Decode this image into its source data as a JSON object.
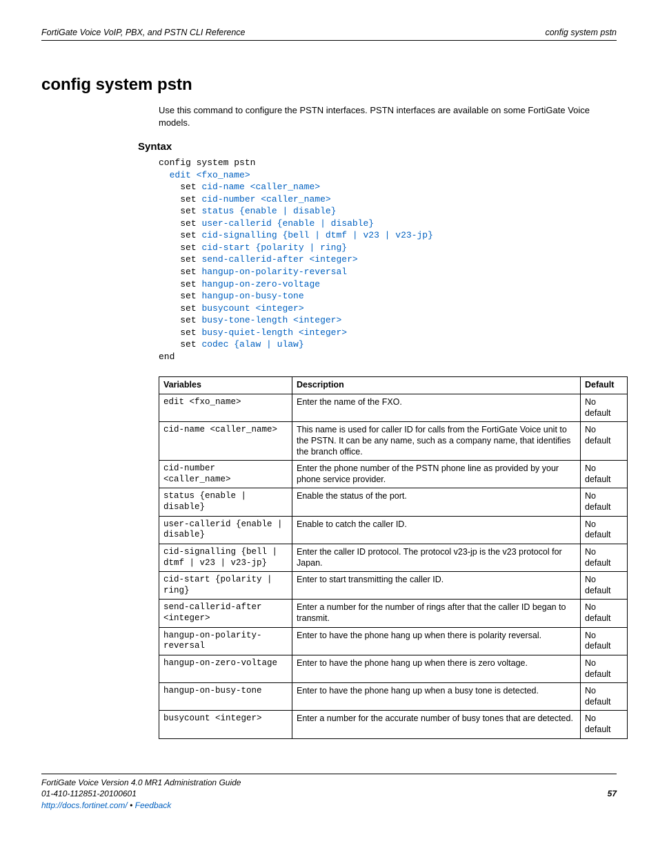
{
  "header": {
    "left": "FortiGate Voice VoIP, PBX, and PSTN CLI Reference",
    "right": "config system pstn"
  },
  "title": "config system pstn",
  "intro": "Use this command to configure the PSTN interfaces. PSTN interfaces are available on some FortiGate Voice models.",
  "syntax_heading": "Syntax",
  "code": {
    "l0": "config system pstn",
    "l1": "edit <fxo_name>",
    "l2": "set",
    "l2v": "cid-name <caller_name>",
    "l3": "set",
    "l3v": "cid-number <caller_name>",
    "l4": "set",
    "l4v": "status {enable | disable}",
    "l5": "set",
    "l5v": "user-callerid {enable | disable}",
    "l6": "set",
    "l6v": "cid-signalling {bell | dtmf | v23 | v23-jp}",
    "l7": "set",
    "l7v": "cid-start {polarity | ring}",
    "l8": "set",
    "l8v": "send-callerid-after <integer>",
    "l9": "set",
    "l9v": "hangup-on-polarity-reversal",
    "l10": "set",
    "l10v": "hangup-on-zero-voltage",
    "l11": "set",
    "l11v": "hangup-on-busy-tone",
    "l12": "set",
    "l12v": "busycount <integer>",
    "l13": "set",
    "l13v": "busy-tone-length <integer>",
    "l14": "set",
    "l14v": "busy-quiet-length <integer>",
    "l15": "set",
    "l15v": "codec {alaw | ulaw}",
    "l16": "end"
  },
  "table": {
    "h1": "Variables",
    "h2": "Description",
    "h3": "Default",
    "rows": [
      {
        "v": "edit <fxo_name>",
        "d": "Enter the name of the FXO.",
        "def": "No default"
      },
      {
        "v": "cid-name <caller_name>",
        "d": "This name is used for caller ID for calls from the FortiGate Voice unit to the PSTN. It can be any name, such as a company name, that identifies the branch office.",
        "def": "No default"
      },
      {
        "v": "cid-number <caller_name>",
        "d": "Enter the phone number of the PSTN phone line as provided by your phone service provider.",
        "def": "No default"
      },
      {
        "v": "status {enable | disable}",
        "d": "Enable the status of the port.",
        "def": "No default"
      },
      {
        "v": "user-callerid {enable | disable}",
        "d": "Enable to catch the caller ID.",
        "def": "No default"
      },
      {
        "v": "cid-signalling {bell | dtmf | v23 | v23-jp}",
        "d": "Enter the caller ID protocol. The protocol v23-jp is the v23 protocol for Japan.",
        "def": "No default"
      },
      {
        "v": "cid-start {polarity | ring}",
        "d": "Enter to start transmitting the caller ID.",
        "def": "No default"
      },
      {
        "v": "send-callerid-after <integer>",
        "d": "Enter a number for the number of rings after that the caller ID began to transmit.",
        "def": "No default"
      },
      {
        "v": "hangup-on-polarity-reversal",
        "d": "Enter to have the phone hang up when there is polarity reversal.",
        "def": "No default"
      },
      {
        "v": "hangup-on-zero-voltage",
        "d": "Enter to have the phone hang up when there is zero voltage.",
        "def": "No default"
      },
      {
        "v": "hangup-on-busy-tone",
        "d": "Enter to have the phone hang up when a busy tone is detected.",
        "def": "No default"
      },
      {
        "v": "busycount <integer>",
        "d": "Enter a number for the accurate number of busy tones that are detected.",
        "def": "No default"
      }
    ]
  },
  "footer": {
    "line1": "FortiGate Voice Version 4.0 MR1 Administration Guide",
    "line2": "01-410-112851-20100601",
    "url": "http://docs.fortinet.com/",
    "sep": " • ",
    "feedback": "Feedback",
    "page": "57"
  }
}
